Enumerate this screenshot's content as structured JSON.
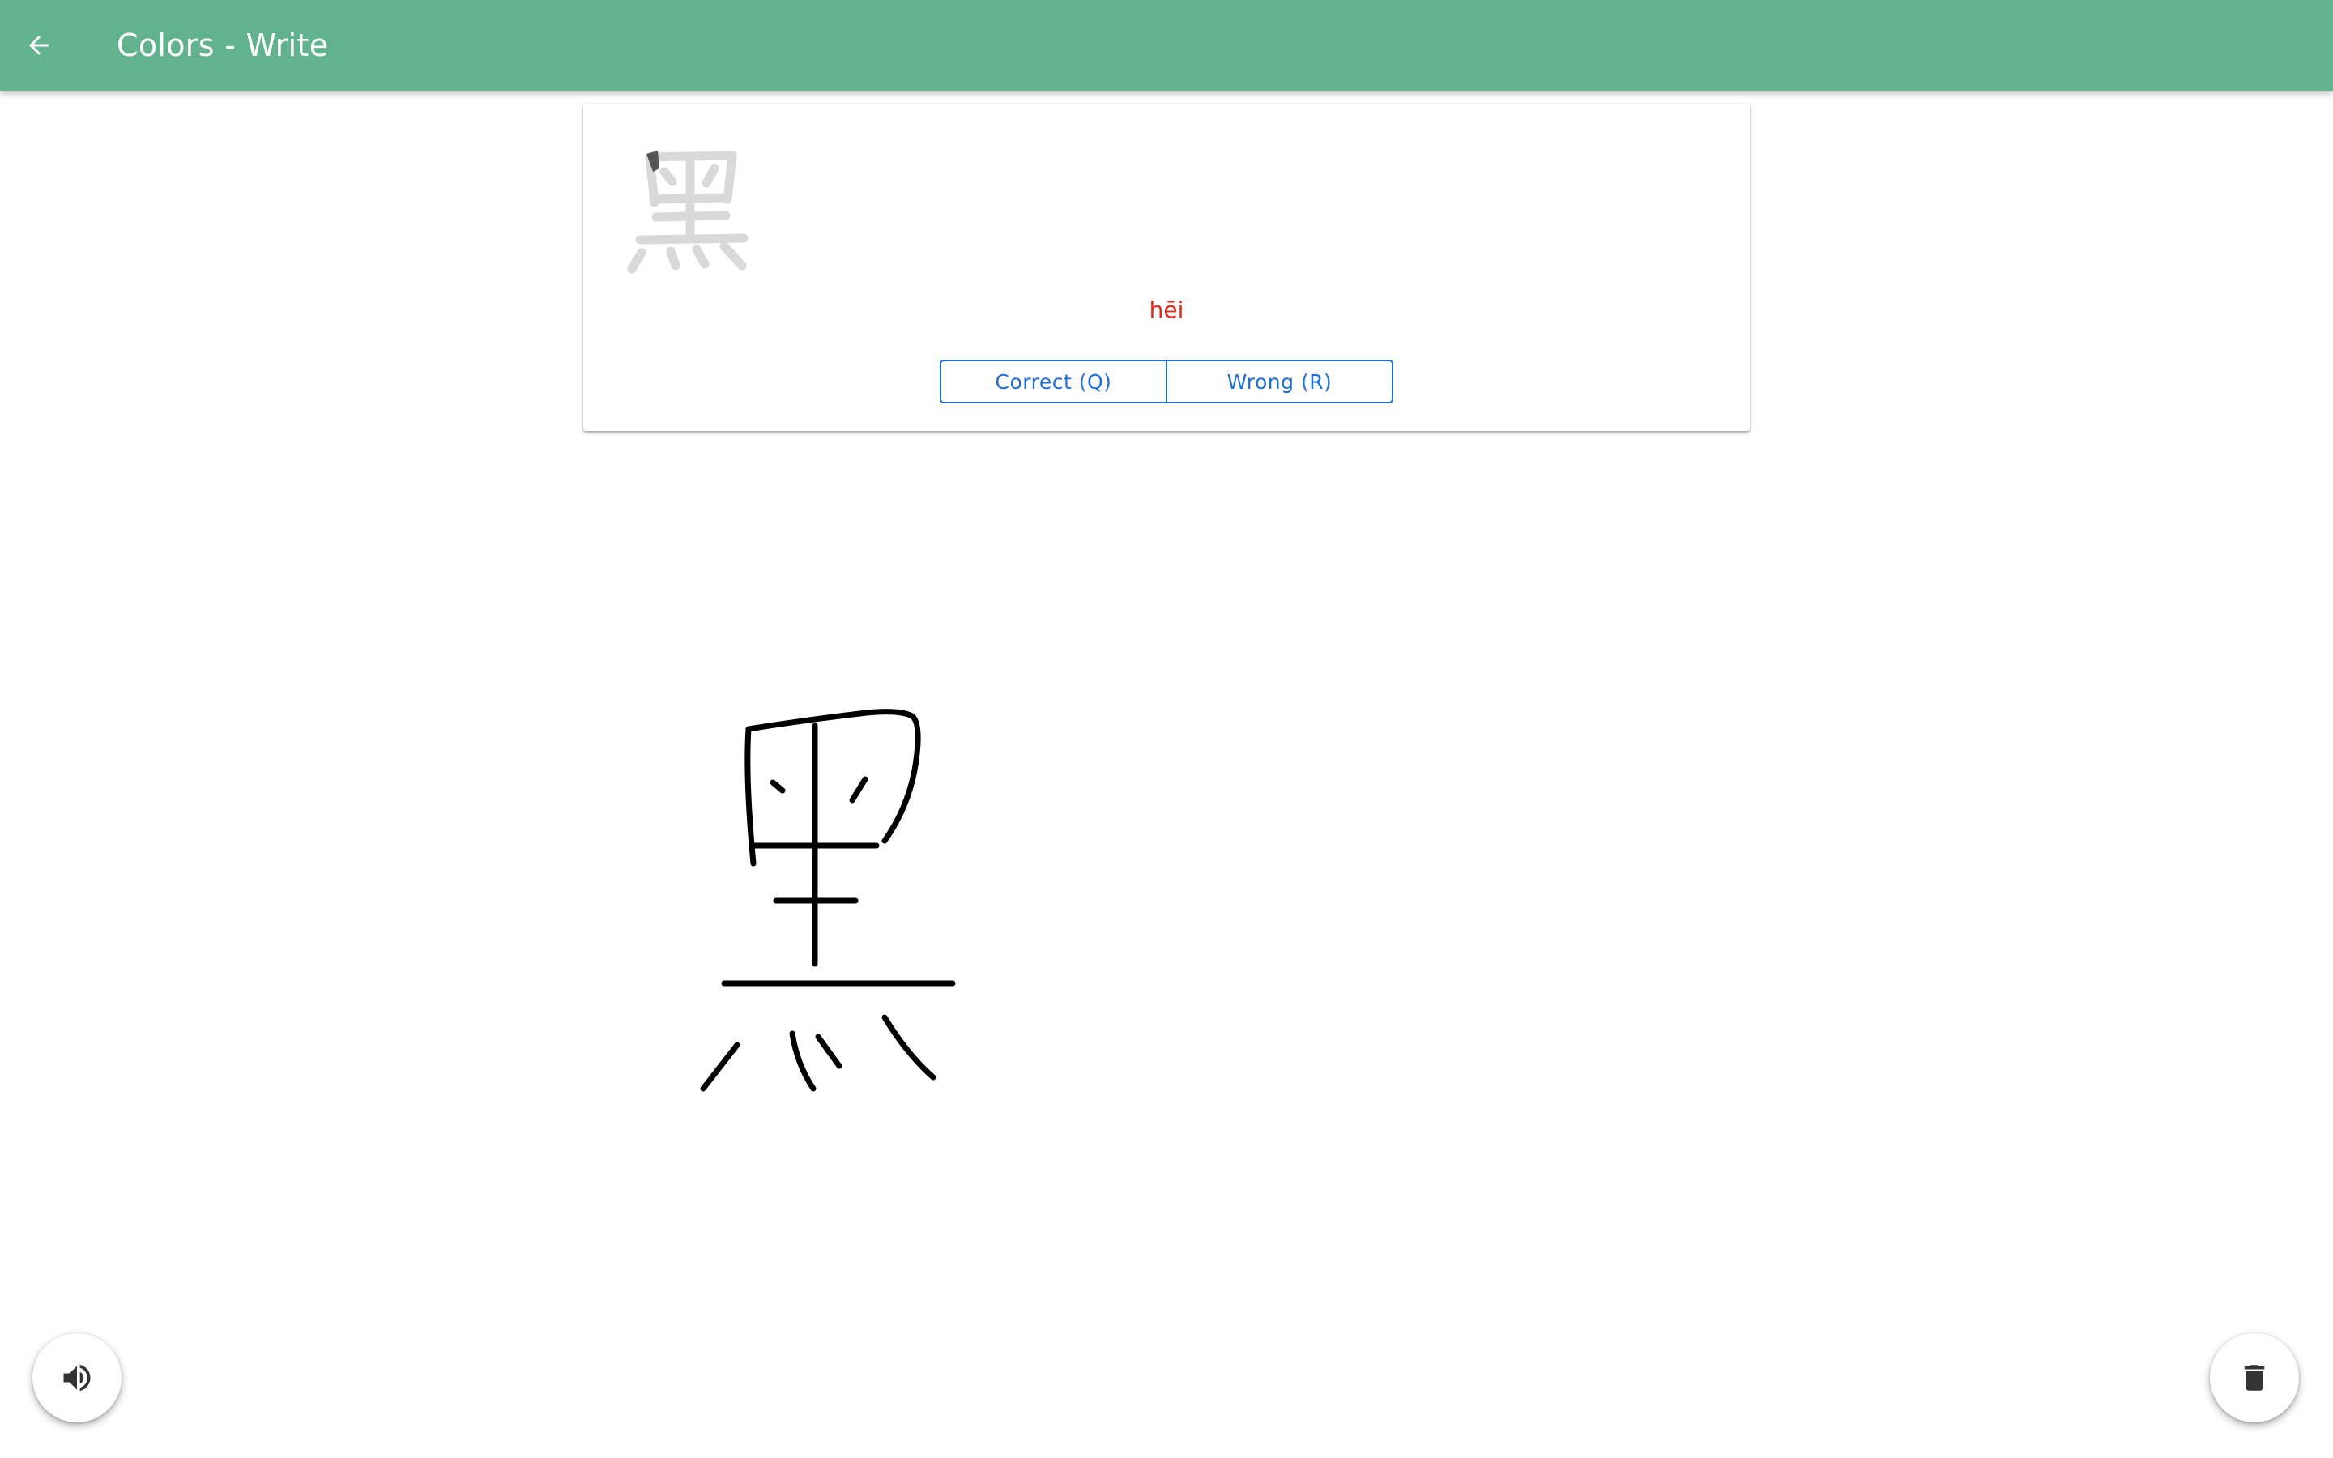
{
  "toolbar": {
    "title": "Colors - Write",
    "back_icon": "arrow-left-icon",
    "color": "#62b28d"
  },
  "card": {
    "hint_character": "黑",
    "pinyin": "hēi",
    "pinyin_color": "#e02b1d",
    "buttons": {
      "correct_label": "Correct (Q)",
      "wrong_label": "Wrong (R)"
    },
    "button_color": "#1e6fd9"
  },
  "drawing": {
    "character": "黑",
    "ink_color": "#000000"
  },
  "fabs": {
    "sound_icon": "speaker-icon",
    "clear_icon": "trash-icon"
  }
}
